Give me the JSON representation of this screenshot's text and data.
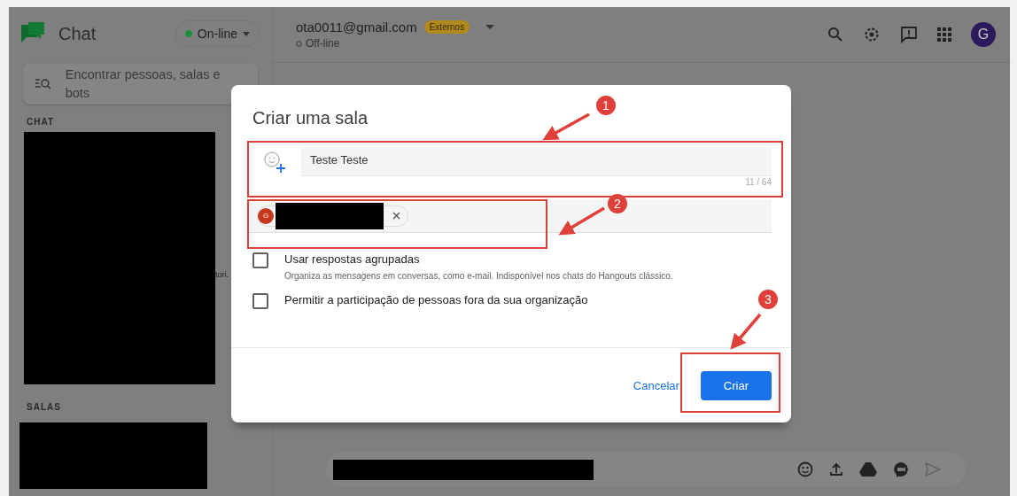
{
  "app": {
    "name": "Chat",
    "status": {
      "label": "On-line",
      "color": "#1e8e3e"
    }
  },
  "search": {
    "placeholder": "Encontrar pessoas, salas e bots"
  },
  "sidebar": {
    "sections": [
      {
        "title": "CHAT"
      },
      {
        "title": "SALAS"
      }
    ],
    "snippet": "tori."
  },
  "header": {
    "account": "ota0011@gmail.com",
    "badge": "Externos",
    "presence": "Off-line",
    "avatar": "G"
  },
  "dialog": {
    "title": "Criar uma sala",
    "name_field": {
      "value": "Teste Teste",
      "counter": "11 / 64"
    },
    "people_field": {
      "chip_avatar": "G"
    },
    "options": [
      {
        "label": "Usar respostas agrupadas",
        "description": "Organiza as mensagens em conversas, como e-mail. Indisponível nos chats do Hangouts clássico.",
        "checked": false
      },
      {
        "label": "Permitir a participação de pessoas fora da sua organização",
        "checked": false
      }
    ],
    "buttons": [
      {
        "label": "Cancelar",
        "kind": "text"
      },
      {
        "label": "Criar",
        "kind": "primary"
      }
    ]
  },
  "annotations": [
    {
      "number": "1"
    },
    {
      "number": "2"
    },
    {
      "number": "3"
    }
  ]
}
